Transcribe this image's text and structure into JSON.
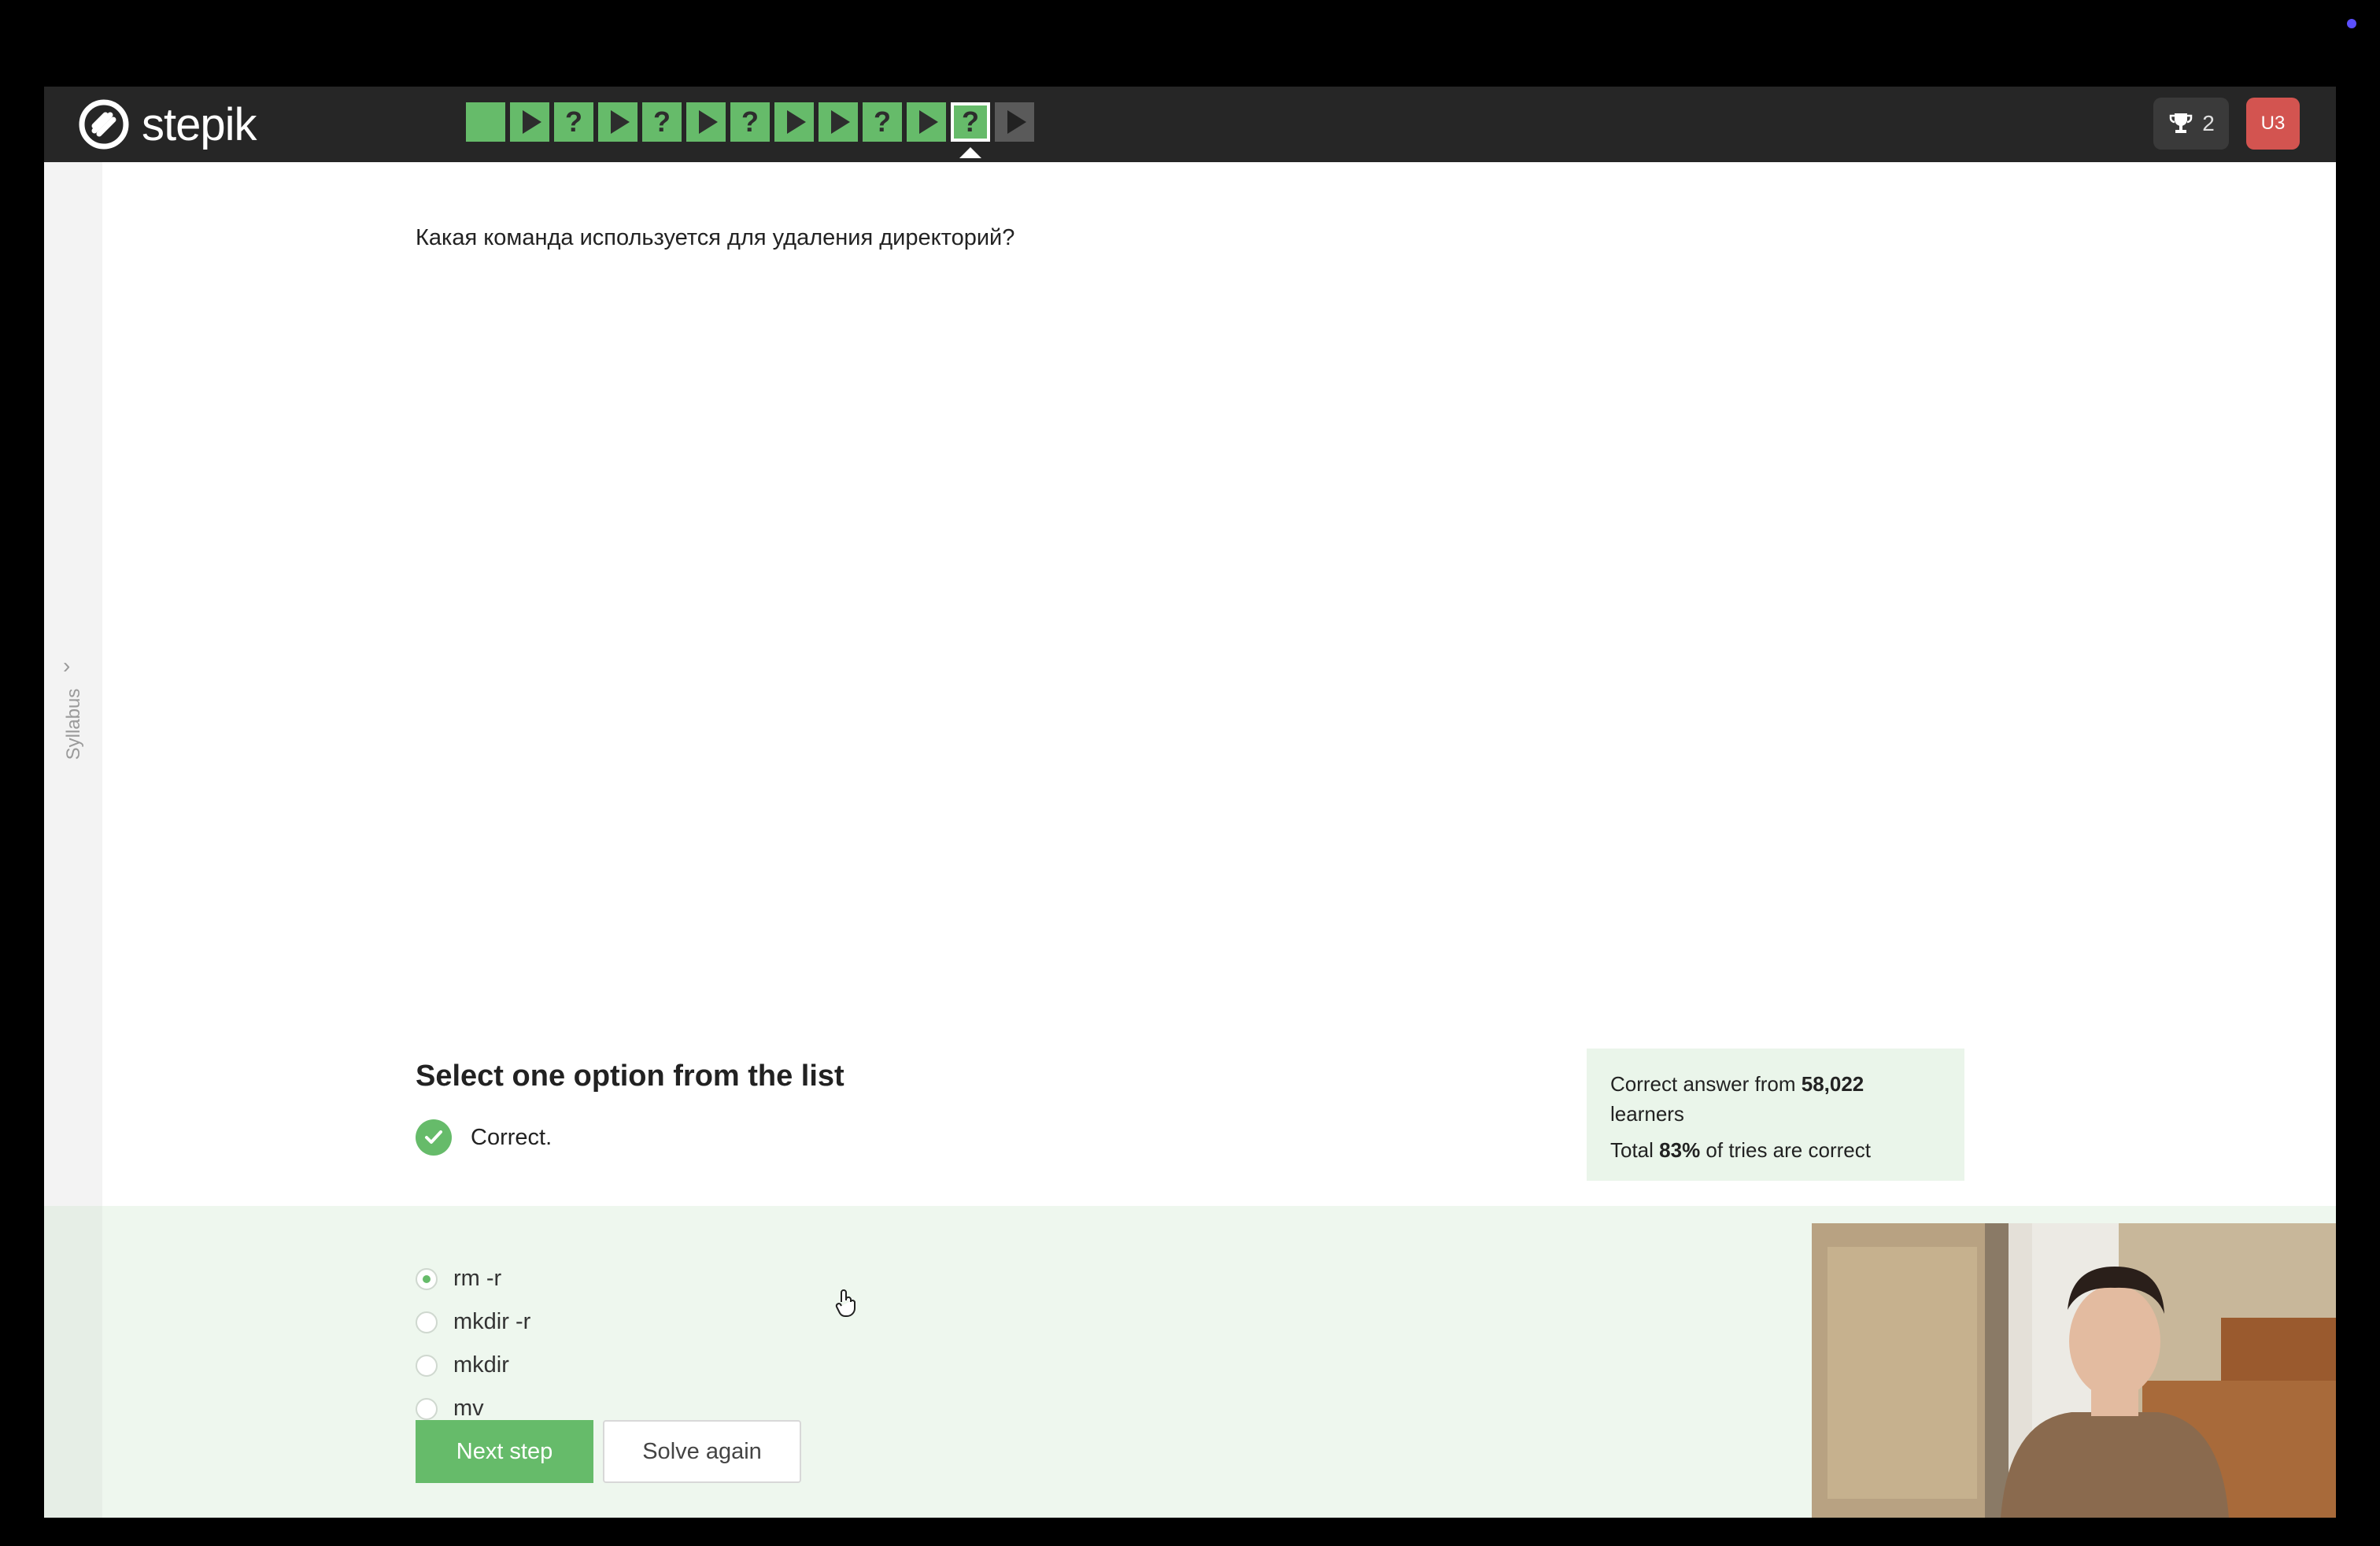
{
  "app": {
    "logo_text": "stepik"
  },
  "header": {
    "steps": [
      {
        "type": "text",
        "state": "done"
      },
      {
        "type": "video",
        "state": "done"
      },
      {
        "type": "quiz",
        "state": "done"
      },
      {
        "type": "video",
        "state": "done"
      },
      {
        "type": "quiz",
        "state": "done"
      },
      {
        "type": "video",
        "state": "done"
      },
      {
        "type": "quiz",
        "state": "done"
      },
      {
        "type": "video",
        "state": "done"
      },
      {
        "type": "video",
        "state": "done"
      },
      {
        "type": "quiz",
        "state": "done"
      },
      {
        "type": "video",
        "state": "done"
      },
      {
        "type": "quiz",
        "state": "current"
      },
      {
        "type": "video",
        "state": "pending"
      }
    ],
    "trophy_count": "2",
    "avatar_initials": "U3"
  },
  "sidebar": {
    "label": "Syllabus",
    "chevron": "›"
  },
  "question": {
    "text": "Какая команда используется для удаления директорий?"
  },
  "quiz": {
    "title": "Select one option from the list",
    "status": "Correct.",
    "options": [
      {
        "label": "rm -r",
        "selected": true
      },
      {
        "label": "mkdir -r",
        "selected": false
      },
      {
        "label": "mkdir",
        "selected": false
      },
      {
        "label": "mv",
        "selected": false
      }
    ],
    "next_label": "Next step",
    "solve_again_label": "Solve again"
  },
  "stats": {
    "prefix": "Correct answer from ",
    "learners_count": "58,022",
    "learners_suffix": "learners",
    "total_prefix": "Total ",
    "percent": "83%",
    "total_suffix": " of tries are correct"
  },
  "colors": {
    "accent": "#66bb6a",
    "header_bg": "#262626",
    "avatar_bg": "#d35450",
    "answers_bg": "#eef7ee"
  },
  "icons": [
    "stepik-logo-icon",
    "play-icon",
    "question-icon",
    "trophy-icon",
    "check-icon",
    "hand-cursor-icon",
    "chevron-right-icon"
  ]
}
